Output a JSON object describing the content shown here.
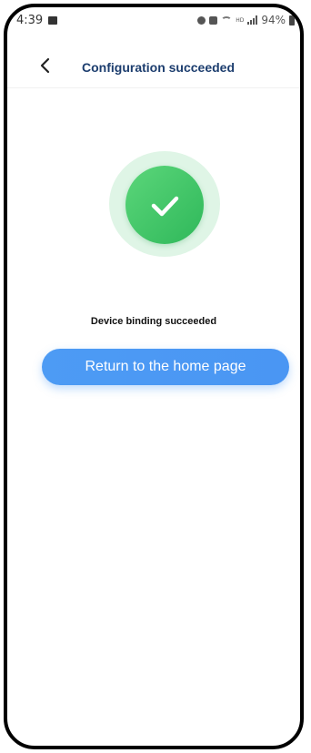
{
  "status_bar": {
    "time": "4:39",
    "battery": "94%",
    "icons": [
      "gallery-icon",
      "alarm-icon",
      "mute-icon",
      "wifi-icon",
      "hd-icon",
      "signal-icon",
      "battery-icon"
    ]
  },
  "header": {
    "back_icon": "chevron-left-icon",
    "title": "Configuration succeeded"
  },
  "main": {
    "success_icon": "check-icon",
    "message": "Device binding succeeded",
    "home_button_label": "Return to the home page"
  },
  "colors": {
    "title": "#1c3d6e",
    "success_green": "#2fb85a",
    "success_halo": "#dff5e6",
    "button_blue": "#4d9bf4"
  }
}
